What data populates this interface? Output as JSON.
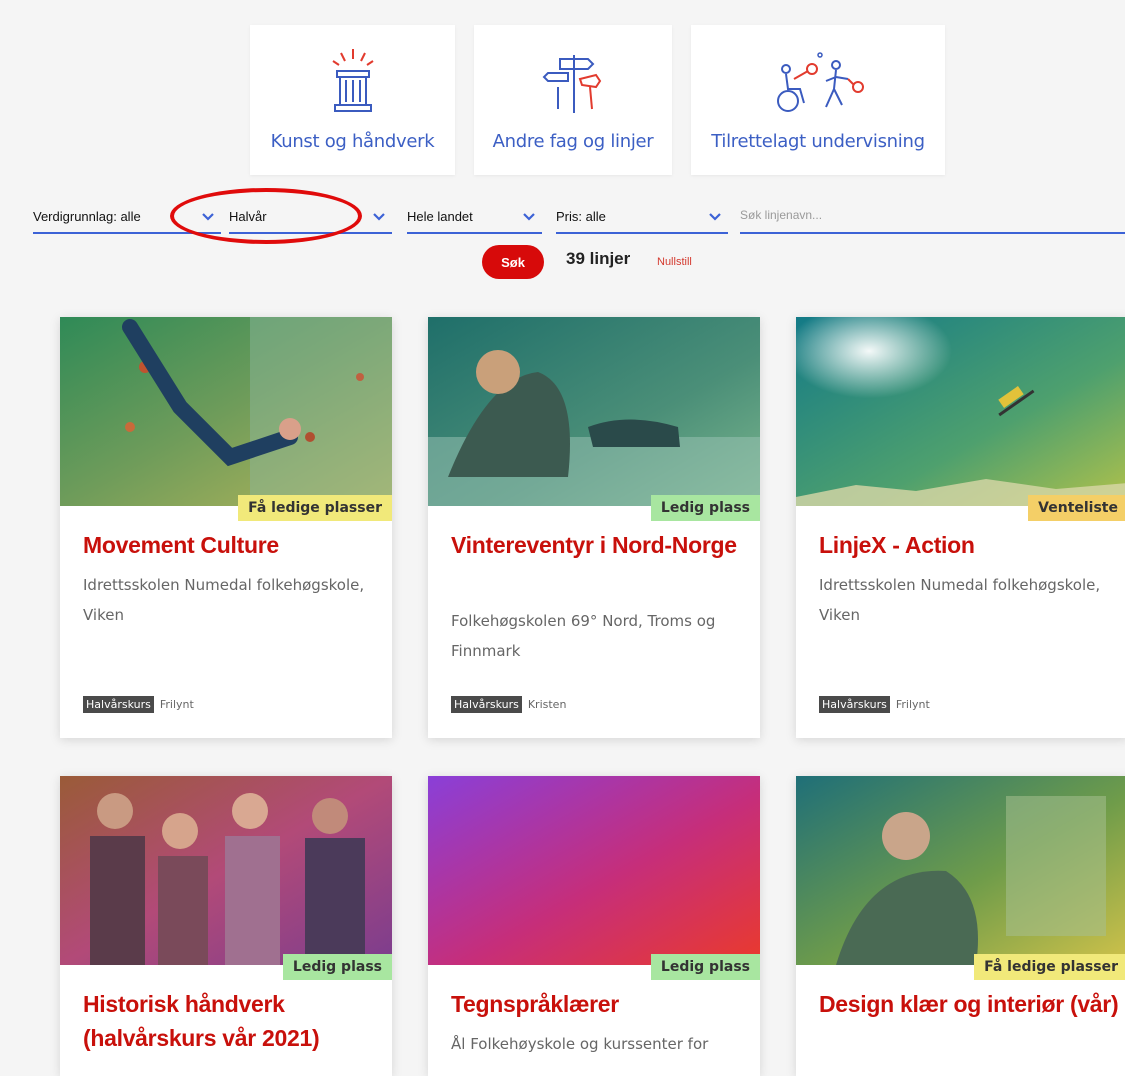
{
  "categories": [
    {
      "label": "Kunst og håndverk",
      "icon": "pillar-icon"
    },
    {
      "label": "Andre fag og linjer",
      "icon": "signpost-icon"
    },
    {
      "label": "Tilrettelagt undervisning",
      "icon": "wheelchair-sports-icon"
    }
  ],
  "filters": {
    "verdigrunnlag": "Verdigrunnlag: alle",
    "periode": "Halvår",
    "region": "Hele landet",
    "pris": "Pris: alle",
    "search_placeholder": "Søk linjenavn..."
  },
  "results": {
    "search_button": "Søk",
    "count": "39 linjer",
    "reset": "Nullstill"
  },
  "colors": {
    "accent_blue": "#3c62d6",
    "brand_red": "#c8100b",
    "badge_yellow": "#f1e97a",
    "badge_green": "#a8e6a0",
    "badge_orange": "#f4cf67"
  },
  "cards": [
    {
      "badge": "Få ledige plasser",
      "badge_color": "#f1e97a",
      "title": "Movement Culture",
      "school": "Idrettsskolen Numedal folkehøgskole, Viken",
      "tag1": "Halvårskurs",
      "tag2": "Frilynt"
    },
    {
      "badge": "Ledig plass",
      "badge_color": "#a8e6a0",
      "title": "Vintereventyr i Nord-Norge",
      "school": "Folkehøgskolen 69° Nord, Troms og Finnmark",
      "tag1": "Halvårskurs",
      "tag2": "Kristen"
    },
    {
      "badge": "Venteliste",
      "badge_color": "#f4cf67",
      "title": "LinjeX - Action",
      "school": "Idrettsskolen Numedal folkehøgskole, Viken",
      "tag1": "Halvårskurs",
      "tag2": "Frilynt"
    },
    {
      "badge": "Ledig plass",
      "badge_color": "#a8e6a0",
      "title": "Historisk håndverk (halvårskurs vår 2021)",
      "school": ""
    },
    {
      "badge": "Ledig plass",
      "badge_color": "#a8e6a0",
      "title": "Tegnspråklærer",
      "school": "Ål Folkehøyskole og kurssenter for"
    },
    {
      "badge": "Få ledige plasser",
      "badge_color": "#f1e97a",
      "title": "Design klær og interiør (vår)",
      "school": ""
    }
  ]
}
